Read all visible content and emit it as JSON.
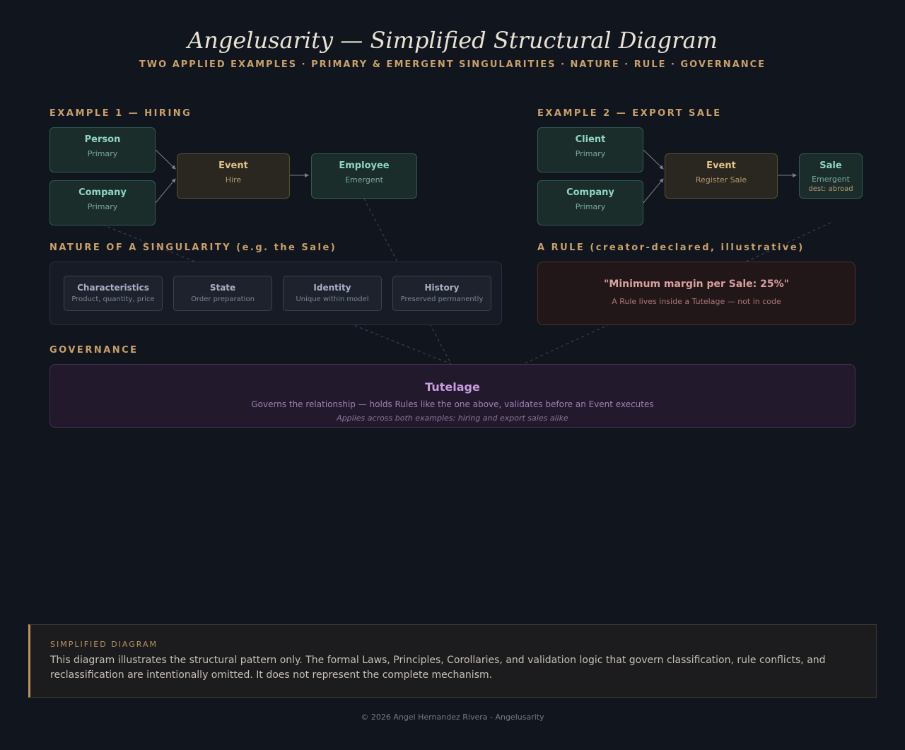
{
  "header": {
    "title": "Angelusarity — Simplified Structural Diagram",
    "subtitle": "TWO APPLIED EXAMPLES · PRIMARY & EMERGENT SINGULARITIES · NATURE · RULE · GOVERNANCE"
  },
  "example1": {
    "heading": "EXAMPLE 1 — HIRING",
    "person": {
      "title": "Person",
      "kind": "Primary"
    },
    "company": {
      "title": "Company",
      "kind": "Primary"
    },
    "event": {
      "title": "Event",
      "kind": "Hire"
    },
    "result": {
      "title": "Employee",
      "kind": "Emergent"
    }
  },
  "example2": {
    "heading": "EXAMPLE 2 — EXPORT SALE",
    "client": {
      "title": "Client",
      "kind": "Primary"
    },
    "company": {
      "title": "Company",
      "kind": "Primary"
    },
    "event": {
      "title": "Event",
      "kind": "Register Sale"
    },
    "result": {
      "title": "Sale",
      "kind": "Emergent",
      "note": "dest: abroad"
    }
  },
  "nature": {
    "heading": "NATURE OF A SINGULARITY (e.g. the Sale)",
    "items": [
      {
        "title": "Characteristics",
        "desc": "Product, quantity, price"
      },
      {
        "title": "State",
        "desc": "Order preparation"
      },
      {
        "title": "Identity",
        "desc": "Unique within model"
      },
      {
        "title": "History",
        "desc": "Preserved permanently"
      }
    ]
  },
  "rule": {
    "heading": "A RULE (creator-declared, illustrative)",
    "quote": "\"Minimum margin per Sale: 25%\"",
    "desc": "A Rule lives inside a Tutelage — not in code"
  },
  "governance": {
    "heading": "GOVERNANCE",
    "title": "Tutelage",
    "desc": "Governs the relationship — holds Rules like the one above, validates before an Event executes",
    "note": "Applies across both examples: hiring and export sales alike"
  },
  "notice": {
    "heading": "SIMPLIFIED DIAGRAM",
    "body": "This diagram illustrates the structural pattern only. The formal Laws, Principles, Corollaries, and validation logic that govern classification, rule conflicts, and reclassification are intentionally omitted. It does not represent the complete mechanism."
  },
  "footer": "© 2026 Angel Hernandez Rivera - Angelusarity",
  "colors": {
    "background": "#11151d",
    "accent": "#c9a06a",
    "primary_node": "#8fd6c4",
    "event_node": "#e3c48a",
    "rule": "#d9a0a0",
    "governance": "#c89ee0"
  }
}
